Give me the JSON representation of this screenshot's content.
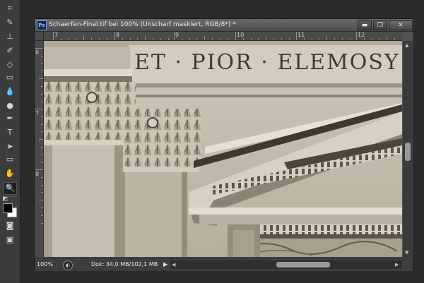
{
  "tools": [
    {
      "name": "crop-tool-icon",
      "glyph": "⌗"
    },
    {
      "name": "brush-tool-icon",
      "glyph": "✎"
    },
    {
      "name": "stamp-tool-icon",
      "glyph": "⊥"
    },
    {
      "name": "history-brush-icon",
      "glyph": "✐"
    },
    {
      "name": "eraser-tool-icon",
      "glyph": "◇"
    },
    {
      "name": "gradient-tool-icon",
      "glyph": "▭"
    },
    {
      "name": "blur-tool-icon",
      "glyph": "💧"
    },
    {
      "name": "dodge-tool-icon",
      "glyph": "●"
    },
    {
      "name": "pen-tool-icon",
      "glyph": "✒"
    },
    {
      "name": "type-tool-icon",
      "glyph": "T"
    },
    {
      "name": "path-selection-icon",
      "glyph": "➤"
    },
    {
      "name": "rectangle-tool-icon",
      "glyph": "▭"
    },
    {
      "name": "hand-tool-icon",
      "glyph": "✋"
    },
    {
      "name": "zoom-tool-icon",
      "glyph": "🔍"
    },
    {
      "name": "default-colors-icon",
      "glyph": "◩"
    },
    {
      "name": "quick-mask-icon",
      "glyph": "◙"
    },
    {
      "name": "screen-mode-icon",
      "glyph": "▣"
    }
  ],
  "colors": {
    "foreground": "#000000",
    "background": "#ffffff",
    "app_bg": "#2b2b2b",
    "panel_bg": "#3c3c3c"
  },
  "document": {
    "badge": "Ps",
    "title": "Schaerfen-Final.tif bei 100% (Unscharf maskiert, RGB/8*) *",
    "buttons": {
      "minimize": "▬",
      "restore": "❐",
      "close": "✕"
    }
  },
  "ruler": {
    "horizontal_labels": [
      "7",
      "8",
      "9",
      "10",
      "11",
      "12"
    ],
    "vertical_labels": [
      "6",
      "7",
      "8"
    ]
  },
  "canvas": {
    "inscription": "ET · PIOR · ELEMOSY"
  },
  "status": {
    "zoom": "100%",
    "doc_info": "Dok: 34,0 MB/102,1 MB",
    "menu_arrow": "▶"
  },
  "scroll": {
    "arrow_up": "▲",
    "arrow_down": "▼",
    "arrow_left": "◀",
    "arrow_right": "▶"
  }
}
